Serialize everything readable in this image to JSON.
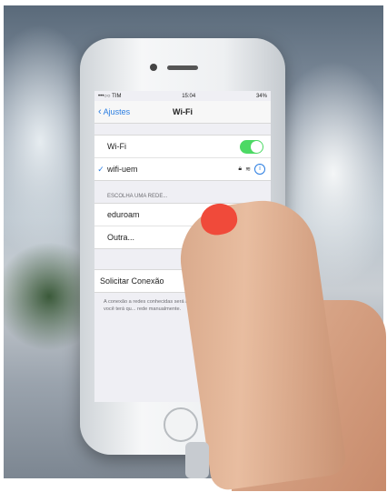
{
  "status_bar": {
    "carrier": "•••○○ TIM",
    "time": "15:04",
    "battery": "34%"
  },
  "nav": {
    "back_label": "Ajustes",
    "title": "Wi-Fi"
  },
  "wifi": {
    "toggle_label": "Wi-Fi",
    "toggle_on": true,
    "connected_network": "wifi-uem"
  },
  "networks": {
    "section_header": "ESCOLHA UMA REDE...",
    "items": [
      {
        "label": "eduroam"
      },
      {
        "label": "Outra..."
      }
    ]
  },
  "ask_to_join": {
    "label": "Solicitar Conexão",
    "note": "A conexão a redes conhecidas será a... houver redes conhecidas, você terá qu... rede manualmente."
  },
  "colors": {
    "accent": "#2a7de1",
    "toggle_on": "#4cd964",
    "nail_polish": "#f04a3a"
  }
}
